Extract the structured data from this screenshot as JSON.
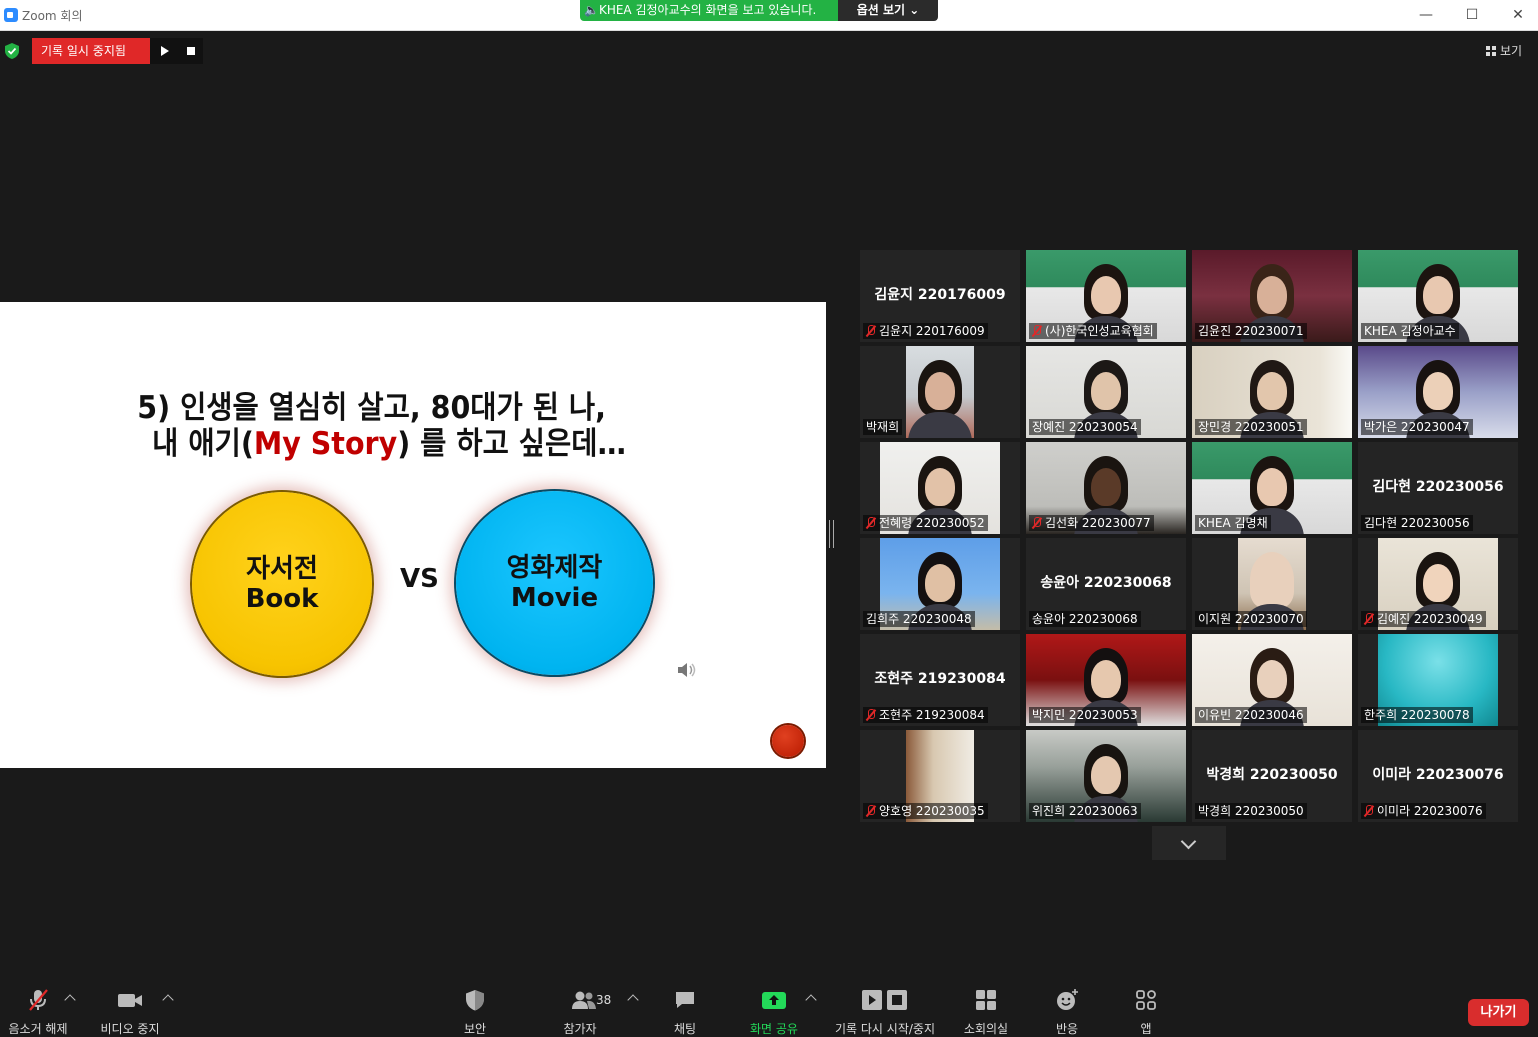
{
  "window": {
    "title": "Zoom 회의",
    "share_banner": "KHEA 김정아교수의 화면을 보고 있습니다.",
    "options_label": "옵션 보기",
    "minimize": "—",
    "maximize": "☐",
    "close": "✕"
  },
  "recording": {
    "status": "기록 일시 중지됨"
  },
  "view_label": "보기",
  "slide": {
    "title_line1": "5) 인생을 열심히 살고, 80대가 된 나,",
    "title_line2_pre": "내 애기(",
    "title_line2_red": "My Story",
    "title_line2_post": ") 를 하고 싶은데…",
    "left_circle": [
      "자서전",
      "Book"
    ],
    "vs": "VS",
    "right_circle": [
      "영화제작",
      "Movie"
    ]
  },
  "colors": {
    "accent_green": "#23b244",
    "record_red": "#e02828",
    "leave_red": "#d92d2d",
    "active_speaker": "#d8e04a",
    "share_green": "#23d959"
  },
  "participants": [
    {
      "big": "김윤지 220176009",
      "label": "김윤지 220176009",
      "muted": true
    },
    {
      "label": "(사)한국인성교육협회",
      "muted": true,
      "video": "green-room"
    },
    {
      "label": "김윤진 220230071",
      "muted": false,
      "video": "bar"
    },
    {
      "label": "KHEA 김정아교수",
      "muted": false,
      "video": "green-room",
      "active": true
    },
    {
      "label": "박재희",
      "muted": false,
      "video": "room-narrow"
    },
    {
      "label": "장예진 220230054",
      "muted": false,
      "video": "room"
    },
    {
      "label": "장민경 220230051",
      "muted": false,
      "video": "room-light"
    },
    {
      "label": "박가은 220230047",
      "muted": false,
      "video": "sky"
    },
    {
      "label": "전혜령 220230052",
      "muted": true,
      "video": "room-narrow2"
    },
    {
      "label": "김선화 220230077",
      "muted": true,
      "video": "ceiling"
    },
    {
      "label": "KHEA 김명채",
      "muted": false,
      "video": "green-room"
    },
    {
      "big": "김다현 220230056",
      "label": "김다현 220230056",
      "muted": false
    },
    {
      "label": "김희주 220230048",
      "muted": false,
      "video": "toy-story"
    },
    {
      "big": "송윤아 220230068",
      "label": "송윤아 220230068",
      "muted": false
    },
    {
      "label": "이지원 220230070",
      "muted": false,
      "video": "room-narrow3"
    },
    {
      "label": "김예진 220230049",
      "muted": true,
      "video": "room-narrow4"
    },
    {
      "big": "조현주 219230084",
      "label": "조현주 219230084",
      "muted": true
    },
    {
      "label": "박지민 220230053",
      "muted": false,
      "video": "cartoon"
    },
    {
      "label": "이유빈 220230046",
      "muted": false,
      "video": "mask"
    },
    {
      "label": "한주희 220230078",
      "muted": false,
      "video": "teal"
    },
    {
      "label": "양호영 220230035",
      "muted": true,
      "video": "room-narrow5"
    },
    {
      "label": "위진희 220230063",
      "muted": false,
      "video": "dark-room"
    },
    {
      "big": "박경희 220230050",
      "label": "박경희 220230050",
      "muted": false
    },
    {
      "big": "이미라 220230076",
      "label": "이미라 220230076",
      "muted": true
    }
  ],
  "toolbar": {
    "unmute": "음소거 해제",
    "stop_video": "비디오 중지",
    "security": "보안",
    "participants": "참가자",
    "participants_count": "38",
    "chat": "채팅",
    "share_screen": "화면 공유",
    "record": "기록 다시 시작/중지",
    "breakout": "소회의실",
    "reactions": "반응",
    "apps": "앱",
    "leave": "나가기"
  }
}
